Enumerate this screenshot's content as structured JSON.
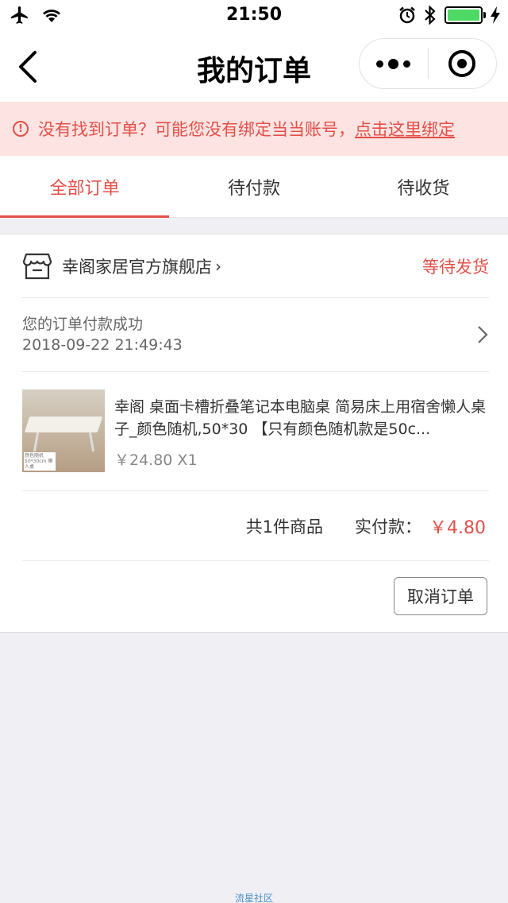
{
  "status_bar": {
    "time": "21:50",
    "icons": [
      "airplane-icon",
      "wifi-icon",
      "alarm-icon",
      "bluetooth-icon",
      "battery-icon",
      "charging-icon"
    ]
  },
  "nav": {
    "title": "我的订单"
  },
  "alert": {
    "message": "没有找到订单？可能您没有绑定当当账号，",
    "link_text": "点击这里绑定",
    "icon_glyph": "!"
  },
  "tabs": [
    {
      "label": "全部订单",
      "active": true
    },
    {
      "label": "待付款",
      "active": false
    },
    {
      "label": "待收货",
      "active": false
    }
  ],
  "order": {
    "shop_name": "幸阁家居官方旗舰店",
    "shop_chevron": "›",
    "status": "等待发货",
    "payment_message": "您的订单付款成功",
    "payment_time": "2018-09-22 21:49:43",
    "item": {
      "title": "幸阁 桌面卡槽折叠笔记本电脑桌 简易床上用宿舍懒人桌子_颜色随机,50*30 【只有颜色随机款是50c...",
      "price_qty": "￥24.80 X1",
      "thumb_caption": "颜色随机 50*30cm 懒人桌"
    },
    "item_count": "共1件商品",
    "paid_label": "实付款：",
    "paid_amount": "￥4.80",
    "cancel_label": "取消订单"
  },
  "watermark": "流星社区",
  "colors": {
    "accent": "#e2504a",
    "alert_bg": "#fde3e1",
    "page_bg": "#efeff4",
    "battery": "#4cd964"
  }
}
